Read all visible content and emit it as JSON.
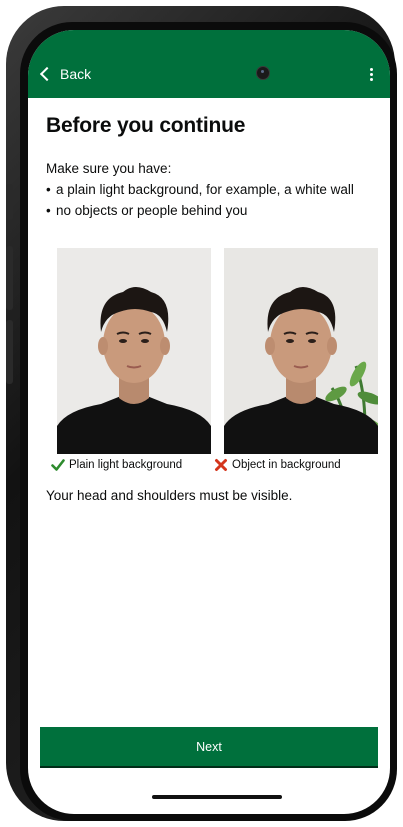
{
  "header": {
    "back_label": "Back",
    "back_icon": "chevron-left-icon",
    "menu_icon": "more-vertical-icon",
    "color": "#00703c"
  },
  "content": {
    "title": "Before you continue",
    "intro": "Make sure you have:",
    "bullets": [
      "a plain light background, for example, a white wall",
      "no objects or people behind you"
    ],
    "examples": [
      {
        "caption": "Plain light background",
        "icon": "check-icon",
        "icon_color": "#2e8b2e"
      },
      {
        "caption": "Object in background",
        "icon": "cross-icon",
        "icon_color": "#d4351c"
      }
    ],
    "note": "Your head and shoulders must be visible."
  },
  "footer": {
    "next_label": "Next",
    "button_color": "#00703c"
  }
}
